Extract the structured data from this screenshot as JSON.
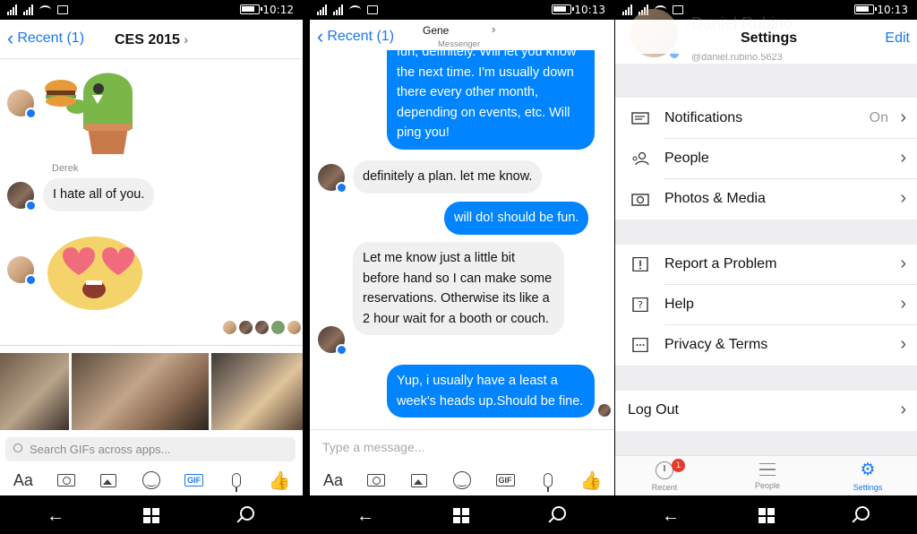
{
  "status": {
    "time_1": "10:12",
    "time_2": "10:13",
    "time_3": "10:13"
  },
  "screen1": {
    "back_label": "Recent (1)",
    "title": "CES 2015",
    "sender_name": "Derek",
    "message": "I hate all of you.",
    "search_placeholder": "Search GIFs across apps..."
  },
  "screen2": {
    "back_label": "Recent (1)",
    "contact_name": "Gene",
    "contact_sub": "Messenger",
    "messages": [
      {
        "dir": "out",
        "text": "fun, definitely. Will let you know the next time. I'm usually down there every other month, depending on events, etc. Will ping you!"
      },
      {
        "dir": "in",
        "text": "definitely a plan. let me know."
      },
      {
        "dir": "out",
        "text": "will do! should be fun."
      },
      {
        "dir": "in",
        "text": "Let me know just a little bit before hand so I can make some reservations. Otherwise its like a 2 hour wait for a booth or couch."
      },
      {
        "dir": "out",
        "text": "Yup, i usually have a least a week's heads up.Should be fine."
      }
    ],
    "input_placeholder": "Type a message..."
  },
  "screen3": {
    "title": "Settings",
    "edit": "Edit",
    "profile_name": "Daniel Rubino",
    "profile_handle": "@daniel.rubino.5623",
    "rows": {
      "notifications": "Notifications",
      "notifications_value": "On",
      "people": "People",
      "photos": "Photos & Media",
      "report": "Report a Problem",
      "help": "Help",
      "privacy": "Privacy & Terms",
      "logout": "Log Out"
    },
    "tabs": {
      "recent": "Recent",
      "people": "People",
      "settings": "Settings",
      "recent_badge": "1"
    }
  },
  "toolbar": {
    "aa": "Aa",
    "gif": "GIF"
  },
  "colors": {
    "accent": "#1877f2",
    "bubble_out": "#0084ff",
    "bubble_in": "#f1f0f0",
    "badge": "#e8392c"
  }
}
